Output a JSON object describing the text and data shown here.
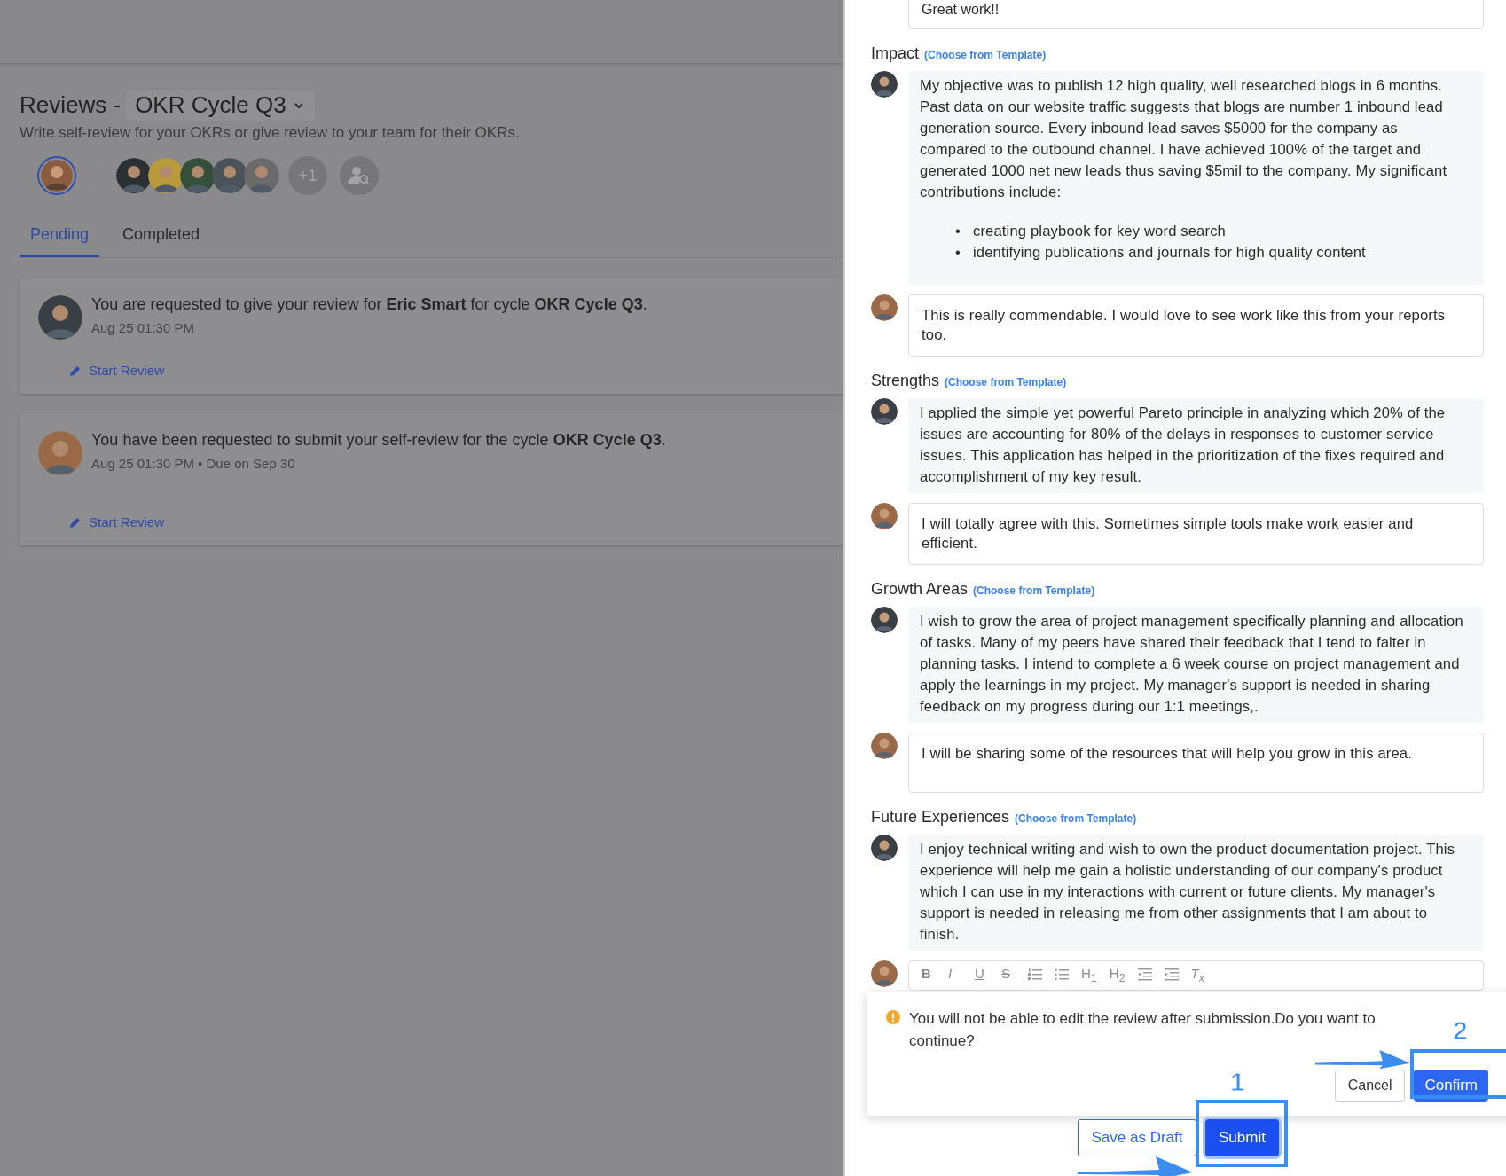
{
  "page": {
    "title": "Reviews -",
    "cycle": "OKR Cycle Q3",
    "subtitle": "Write self-review for your OKRs or give review to your team for their OKRs."
  },
  "people_filter": {
    "self": {
      "selected": true
    },
    "more": "+1"
  },
  "tabs": [
    {
      "label": "Pending",
      "selected": true
    },
    {
      "label": "Completed",
      "selected": false
    }
  ],
  "requests": [
    {
      "message": "You are requested to give your review for **Eric Smart** for cycle **OKR Cycle Q3**.",
      "meta": "Aug 25 01:30 PM",
      "action": "Start Review"
    },
    {
      "message": "You have been requested to submit your self-review for the cycle **OKR Cycle Q3**.",
      "meta": "Aug 25 01:30 PM • Due on Sep 30",
      "action": "Start Review"
    }
  ],
  "drawer": {
    "top_comment": "Great work!!",
    "sections": [
      {
        "title": "Impact",
        "template_link": "(Choose from Template)",
        "entries": [
          {
            "kind": "answer",
            "text": "My objective was to publish 12 high quality, well researched blogs in 6 months. Past data on our website traffic suggests that blogs are number 1 inbound lead generation source. Every inbound lead saves $5000 for the company as compared to the outbound channel. I have achieved 100% of the target and generated 1000 net new leads thus saving $5mil to the company. My significant contributions include:",
            "bullets": [
              {
                "marker": "•",
                "text": "creating playbook for key word search"
              },
              {
                "marker": "•",
                "text": "identifying publications and journals for high quality content"
              }
            ]
          },
          {
            "kind": "comment",
            "text": "This is really commendable. I would love to see work like this from your reports too."
          }
        ]
      },
      {
        "title": "Strengths",
        "template_link": "(Choose from Template)",
        "entries": [
          {
            "kind": "answer",
            "text": "I applied the simple yet powerful Pareto principle in analyzing which 20% of the issues are accounting for 80% of the delays in responses to customer service issues. This application has helped in the prioritization of the fixes required and accomplishment of my key result."
          },
          {
            "kind": "comment",
            "text": "I will totally agree with this. Sometimes simple tools make work easier and efficient."
          }
        ]
      },
      {
        "title": "Growth Areas",
        "template_link": "(Choose from Template)",
        "entries": [
          {
            "kind": "answer",
            "text": "I wish to grow the area of project management specifically planning and allocation of tasks. Many of my peers have shared their feedback that I tend to falter in planning tasks. I intend to complete a 6 week course on project management and apply the learnings in my project. My manager's support is needed in sharing feedback on my progress during our 1:1 meetings,."
          },
          {
            "kind": "comment",
            "text": "I will be sharing some of the resources that will help you grow in this area."
          }
        ]
      },
      {
        "title": "Future Experiences",
        "template_link": "(Choose from Template)",
        "entries": [
          {
            "kind": "answer",
            "text": "I enjoy technical writing and wish to own the product documentation project. This experience will help me gain a holistic understanding of our company's product which I can use in my interactions with current or future clients. My manager's support is needed in releasing me from other assignments that I am about to finish."
          },
          {
            "kind": "editor"
          }
        ]
      }
    ],
    "toolbar": [
      {
        "kind": "bold",
        "label": "B"
      },
      {
        "kind": "italic",
        "label": "I"
      },
      {
        "kind": "underline",
        "label": "U"
      },
      {
        "kind": "strike",
        "label": "S"
      },
      {
        "kind": "ordered-list"
      },
      {
        "kind": "bullet-list"
      },
      {
        "kind": "heading",
        "label": "H$_{1}$"
      },
      {
        "kind": "heading",
        "label": "H$_{2}$"
      },
      {
        "kind": "outdent"
      },
      {
        "kind": "indent"
      },
      {
        "kind": "clear",
        "label": "T$_{x}$"
      }
    ],
    "confirm": {
      "message": "You will not be able to edit the review after submission.Do you want to continue?",
      "cancel": "Cancel",
      "ok": "Confirm"
    },
    "footer": {
      "draft": "Save as Draft",
      "submit": "Submit"
    },
    "annotations": [
      {
        "number": "1",
        "kind": "submit"
      },
      {
        "number": "2",
        "kind": "confirm"
      }
    ]
  }
}
